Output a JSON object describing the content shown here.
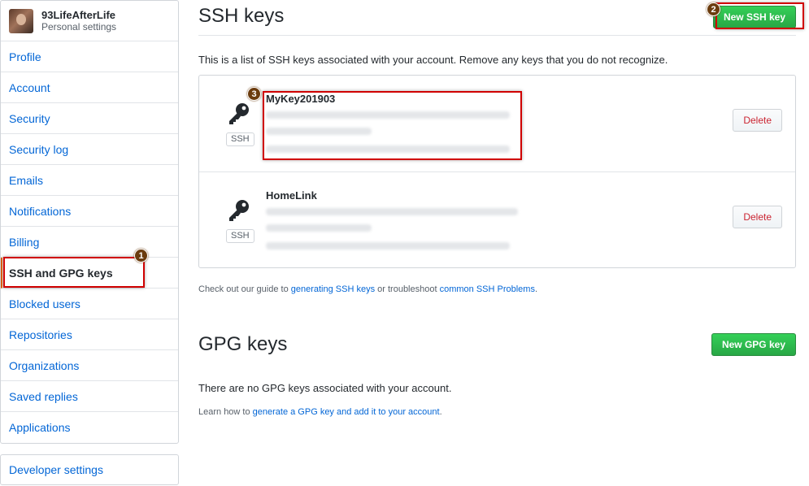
{
  "sidebar": {
    "username": "93LifeAfterLife",
    "subtitle": "Personal settings",
    "items": [
      {
        "label": "Profile"
      },
      {
        "label": "Account"
      },
      {
        "label": "Security"
      },
      {
        "label": "Security log"
      },
      {
        "label": "Emails"
      },
      {
        "label": "Notifications"
      },
      {
        "label": "Billing"
      },
      {
        "label": "SSH and GPG keys",
        "selected": true
      },
      {
        "label": "Blocked users"
      },
      {
        "label": "Repositories"
      },
      {
        "label": "Organizations"
      },
      {
        "label": "Saved replies"
      },
      {
        "label": "Applications"
      }
    ],
    "developer_settings": "Developer settings"
  },
  "ssh": {
    "title": "SSH keys",
    "new_button": "New SSH key",
    "intro": "This is a list of SSH keys associated with your account. Remove any keys that you do not recognize.",
    "keys": [
      {
        "name": "MyKey201903",
        "badge": "SSH",
        "delete_label": "Delete"
      },
      {
        "name": "HomeLink",
        "badge": "SSH",
        "delete_label": "Delete"
      }
    ],
    "help_prefix": "Check out our guide to ",
    "help_link1": "generating SSH keys",
    "help_middle": " or troubleshoot ",
    "help_link2": "common SSH Problems",
    "help_suffix": "."
  },
  "gpg": {
    "title": "GPG keys",
    "new_button": "New GPG key",
    "empty": "There are no GPG keys associated with your account.",
    "learn_prefix": "Learn how to ",
    "learn_link": "generate a GPG key and add it to your account",
    "learn_suffix": "."
  },
  "annotations": {
    "n1": "1",
    "n2": "2",
    "n3": "3"
  },
  "colors": {
    "link": "#0366d6",
    "green": "#28a745",
    "danger": "#cb2431",
    "highlight": "#d00000",
    "badge": "#6b3c0e"
  }
}
